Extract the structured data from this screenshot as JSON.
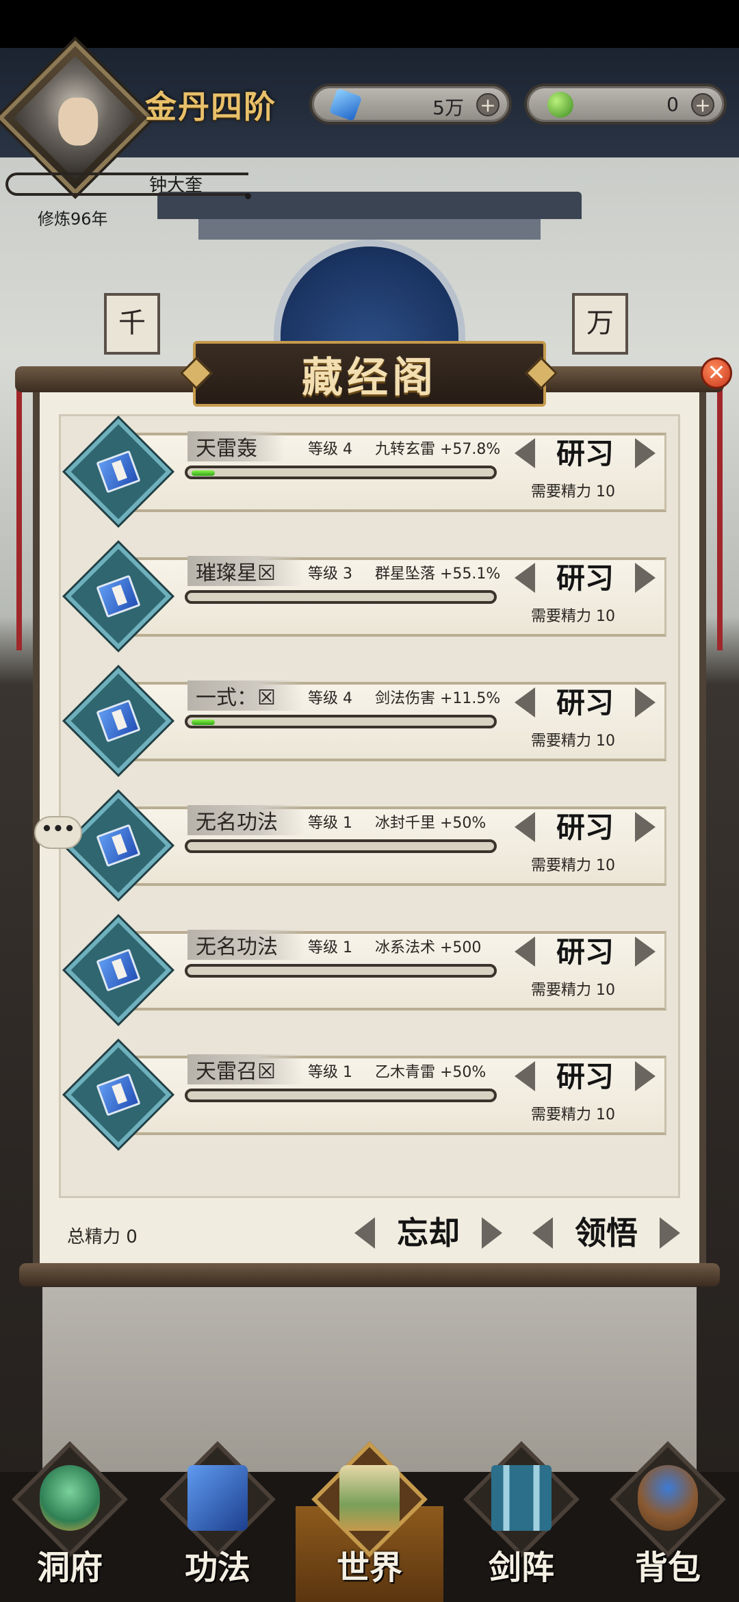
{
  "header": {
    "realm": "金丹四阶",
    "player_name": "钟大奎",
    "cultivation": "修炼96年",
    "currencies": [
      {
        "icon": "blue-crystal-icon",
        "value": "5万"
      },
      {
        "icon": "green-jade-icon",
        "value": "0"
      }
    ],
    "plus_symbol": "+"
  },
  "couplets": {
    "left": "千",
    "right": "万"
  },
  "panel": {
    "title": "藏经阁",
    "close_symbol": "✕",
    "study_label": "研习",
    "skills": [
      {
        "name": "天雷轰",
        "level": "等级 4",
        "effect": "九转玄雷 +57.8%",
        "progress": 0.08,
        "cost": "需要精力 10"
      },
      {
        "name": "璀璨星☒",
        "level": "等级 3",
        "effect": "群星坠落 +55.1%",
        "progress": 0,
        "cost": "需要精力 10"
      },
      {
        "name": "一式：☒",
        "level": "等级 4",
        "effect": "剑法伤害 +11.5%",
        "progress": 0.08,
        "cost": "需要精力 10"
      },
      {
        "name": "无名功法",
        "level": "等级 1",
        "effect": "冰封千里 +50%",
        "progress": 0,
        "cost": "需要精力 10"
      },
      {
        "name": "无名功法",
        "level": "等级 1",
        "effect": "冰系法术 +500",
        "progress": 0,
        "cost": "需要精力 10"
      },
      {
        "name": "天雷召☒",
        "level": "等级 1",
        "effect": "乙木青雷 +50%",
        "progress": 0,
        "cost": "需要精力 10"
      }
    ],
    "total_energy": "总精力 0",
    "forget_label": "忘却",
    "comprehend_label": "领悟",
    "chat_bubble": "•••"
  },
  "nav": {
    "items": [
      {
        "label": "洞府",
        "icon": "cave-dwelling-icon"
      },
      {
        "label": "功法",
        "icon": "technique-book-icon"
      },
      {
        "label": "世界",
        "icon": "world-scroll-icon",
        "active": true
      },
      {
        "label": "剑阵",
        "icon": "sword-array-icon"
      },
      {
        "label": "背包",
        "icon": "backpack-icon"
      }
    ]
  },
  "colors": {
    "accent_gold": "#e8c06a",
    "progress_green": "#2fa316",
    "close_red": "#c8361a"
  }
}
